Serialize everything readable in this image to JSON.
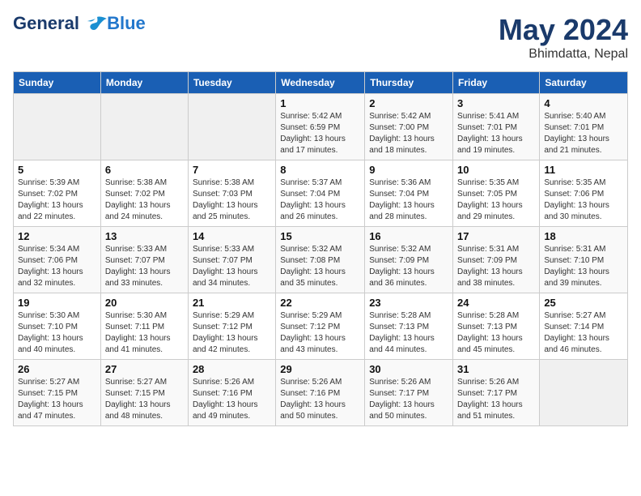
{
  "logo": {
    "line1": "General",
    "line2": "Blue"
  },
  "title": "May 2024",
  "subtitle": "Bhimdatta, Nepal",
  "weekdays": [
    "Sunday",
    "Monday",
    "Tuesday",
    "Wednesday",
    "Thursday",
    "Friday",
    "Saturday"
  ],
  "weeks": [
    [
      {
        "day": "",
        "info": ""
      },
      {
        "day": "",
        "info": ""
      },
      {
        "day": "",
        "info": ""
      },
      {
        "day": "1",
        "info": "Sunrise: 5:42 AM\nSunset: 6:59 PM\nDaylight: 13 hours and 17 minutes."
      },
      {
        "day": "2",
        "info": "Sunrise: 5:42 AM\nSunset: 7:00 PM\nDaylight: 13 hours and 18 minutes."
      },
      {
        "day": "3",
        "info": "Sunrise: 5:41 AM\nSunset: 7:01 PM\nDaylight: 13 hours and 19 minutes."
      },
      {
        "day": "4",
        "info": "Sunrise: 5:40 AM\nSunset: 7:01 PM\nDaylight: 13 hours and 21 minutes."
      }
    ],
    [
      {
        "day": "5",
        "info": "Sunrise: 5:39 AM\nSunset: 7:02 PM\nDaylight: 13 hours and 22 minutes."
      },
      {
        "day": "6",
        "info": "Sunrise: 5:38 AM\nSunset: 7:02 PM\nDaylight: 13 hours and 24 minutes."
      },
      {
        "day": "7",
        "info": "Sunrise: 5:38 AM\nSunset: 7:03 PM\nDaylight: 13 hours and 25 minutes."
      },
      {
        "day": "8",
        "info": "Sunrise: 5:37 AM\nSunset: 7:04 PM\nDaylight: 13 hours and 26 minutes."
      },
      {
        "day": "9",
        "info": "Sunrise: 5:36 AM\nSunset: 7:04 PM\nDaylight: 13 hours and 28 minutes."
      },
      {
        "day": "10",
        "info": "Sunrise: 5:35 AM\nSunset: 7:05 PM\nDaylight: 13 hours and 29 minutes."
      },
      {
        "day": "11",
        "info": "Sunrise: 5:35 AM\nSunset: 7:06 PM\nDaylight: 13 hours and 30 minutes."
      }
    ],
    [
      {
        "day": "12",
        "info": "Sunrise: 5:34 AM\nSunset: 7:06 PM\nDaylight: 13 hours and 32 minutes."
      },
      {
        "day": "13",
        "info": "Sunrise: 5:33 AM\nSunset: 7:07 PM\nDaylight: 13 hours and 33 minutes."
      },
      {
        "day": "14",
        "info": "Sunrise: 5:33 AM\nSunset: 7:07 PM\nDaylight: 13 hours and 34 minutes."
      },
      {
        "day": "15",
        "info": "Sunrise: 5:32 AM\nSunset: 7:08 PM\nDaylight: 13 hours and 35 minutes."
      },
      {
        "day": "16",
        "info": "Sunrise: 5:32 AM\nSunset: 7:09 PM\nDaylight: 13 hours and 36 minutes."
      },
      {
        "day": "17",
        "info": "Sunrise: 5:31 AM\nSunset: 7:09 PM\nDaylight: 13 hours and 38 minutes."
      },
      {
        "day": "18",
        "info": "Sunrise: 5:31 AM\nSunset: 7:10 PM\nDaylight: 13 hours and 39 minutes."
      }
    ],
    [
      {
        "day": "19",
        "info": "Sunrise: 5:30 AM\nSunset: 7:10 PM\nDaylight: 13 hours and 40 minutes."
      },
      {
        "day": "20",
        "info": "Sunrise: 5:30 AM\nSunset: 7:11 PM\nDaylight: 13 hours and 41 minutes."
      },
      {
        "day": "21",
        "info": "Sunrise: 5:29 AM\nSunset: 7:12 PM\nDaylight: 13 hours and 42 minutes."
      },
      {
        "day": "22",
        "info": "Sunrise: 5:29 AM\nSunset: 7:12 PM\nDaylight: 13 hours and 43 minutes."
      },
      {
        "day": "23",
        "info": "Sunrise: 5:28 AM\nSunset: 7:13 PM\nDaylight: 13 hours and 44 minutes."
      },
      {
        "day": "24",
        "info": "Sunrise: 5:28 AM\nSunset: 7:13 PM\nDaylight: 13 hours and 45 minutes."
      },
      {
        "day": "25",
        "info": "Sunrise: 5:27 AM\nSunset: 7:14 PM\nDaylight: 13 hours and 46 minutes."
      }
    ],
    [
      {
        "day": "26",
        "info": "Sunrise: 5:27 AM\nSunset: 7:15 PM\nDaylight: 13 hours and 47 minutes."
      },
      {
        "day": "27",
        "info": "Sunrise: 5:27 AM\nSunset: 7:15 PM\nDaylight: 13 hours and 48 minutes."
      },
      {
        "day": "28",
        "info": "Sunrise: 5:26 AM\nSunset: 7:16 PM\nDaylight: 13 hours and 49 minutes."
      },
      {
        "day": "29",
        "info": "Sunrise: 5:26 AM\nSunset: 7:16 PM\nDaylight: 13 hours and 50 minutes."
      },
      {
        "day": "30",
        "info": "Sunrise: 5:26 AM\nSunset: 7:17 PM\nDaylight: 13 hours and 50 minutes."
      },
      {
        "day": "31",
        "info": "Sunrise: 5:26 AM\nSunset: 7:17 PM\nDaylight: 13 hours and 51 minutes."
      },
      {
        "day": "",
        "info": ""
      }
    ]
  ]
}
